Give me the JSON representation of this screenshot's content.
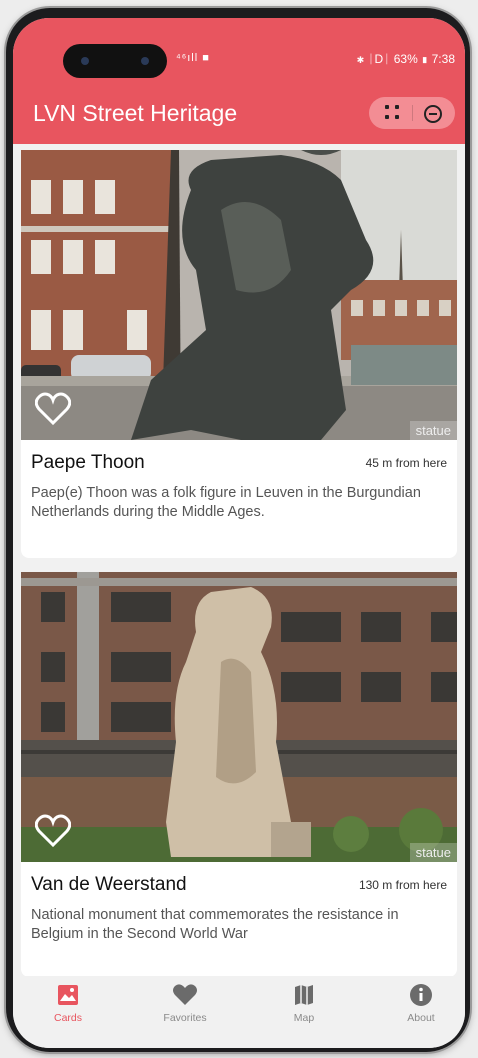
{
  "status_bar": {
    "left_icons": "⁴⁶ıll ■",
    "right_text": "✱ ᛁDᛁ 63% ▮ 7:38"
  },
  "header": {
    "title": "LVN Street Heritage"
  },
  "cards": [
    {
      "title": "Paepe Thoon",
      "distance": "45 m from here",
      "description": "Paep(e) Thoon was a folk figure in Leuven in the Burgundian Netherlands during the Middle Ages.",
      "type": "statue",
      "favorite": false
    },
    {
      "title": "Van de Weerstand",
      "distance": "130 m from here",
      "description": "National monument that commemorates the resistance in Belgium in the Second World War",
      "type": "statue",
      "favorite": false
    }
  ],
  "bottom_nav": {
    "items": [
      {
        "label": "Cards",
        "icon": "image-icon",
        "active": true
      },
      {
        "label": "Favorites",
        "icon": "heart-icon",
        "active": false
      },
      {
        "label": "Map",
        "icon": "map-icon",
        "active": false
      },
      {
        "label": "About",
        "icon": "info-icon",
        "active": false
      }
    ]
  },
  "colors": {
    "accent": "#e8555f",
    "capsule": "#f38d94",
    "nav_inactive": "#8a8a8a"
  }
}
